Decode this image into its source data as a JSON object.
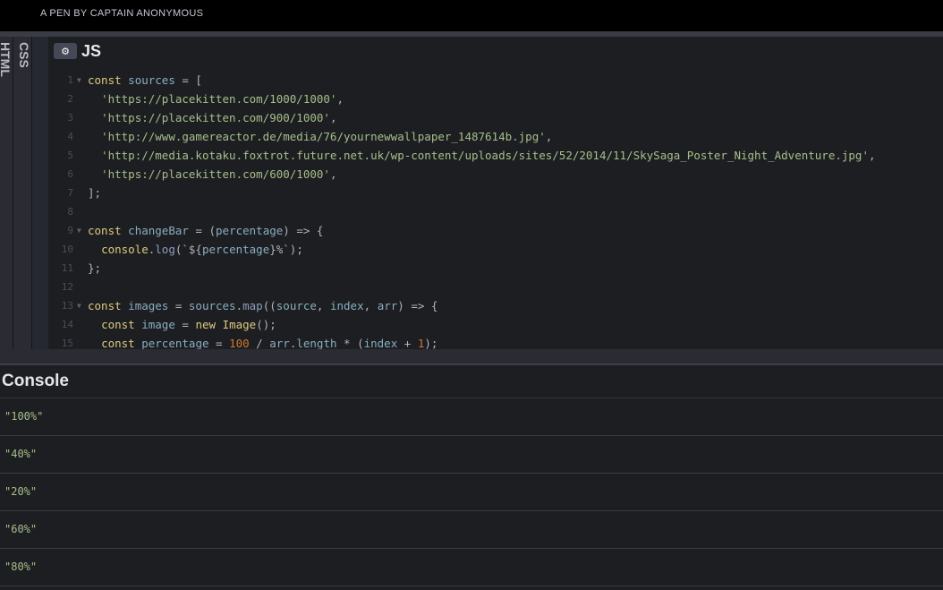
{
  "header": {
    "byline": "A PEN BY CAPTAIN ANONYMOUS"
  },
  "tabs": {
    "html": "HTML",
    "css": "CSS"
  },
  "editor": {
    "title": "JS",
    "settings_icon": "gear-icon",
    "lines": [
      {
        "n": "1",
        "fold": true,
        "tokens": [
          [
            "kw",
            "const"
          ],
          [
            "op",
            " "
          ],
          [
            "var",
            "sources"
          ],
          [
            "op",
            " = ["
          ]
        ]
      },
      {
        "n": "2",
        "fold": false,
        "tokens": [
          [
            "op",
            "  "
          ],
          [
            "str",
            "'https://placekitten.com/1000/1000'"
          ],
          [
            "op",
            ","
          ]
        ]
      },
      {
        "n": "3",
        "fold": false,
        "tokens": [
          [
            "op",
            "  "
          ],
          [
            "str",
            "'https://placekitten.com/900/1000'"
          ],
          [
            "op",
            ","
          ]
        ]
      },
      {
        "n": "4",
        "fold": false,
        "tokens": [
          [
            "op",
            "  "
          ],
          [
            "str",
            "'http://www.gamereactor.de/media/76/yournewwallpaper_1487614b.jpg'"
          ],
          [
            "op",
            ","
          ]
        ]
      },
      {
        "n": "5",
        "fold": false,
        "tokens": [
          [
            "op",
            "  "
          ],
          [
            "str",
            "'http://media.kotaku.foxtrot.future.net.uk/wp-content/uploads/sites/52/2014/11/SkySaga_Poster_Night_Adventure.jpg'"
          ],
          [
            "op",
            ","
          ]
        ]
      },
      {
        "n": "6",
        "fold": false,
        "tokens": [
          [
            "op",
            "  "
          ],
          [
            "str",
            "'https://placekitten.com/600/1000'"
          ],
          [
            "op",
            ","
          ]
        ]
      },
      {
        "n": "7",
        "fold": false,
        "tokens": [
          [
            "op",
            "];"
          ]
        ]
      },
      {
        "n": "8",
        "fold": false,
        "tokens": []
      },
      {
        "n": "9",
        "fold": true,
        "tokens": [
          [
            "kw",
            "const"
          ],
          [
            "op",
            " "
          ],
          [
            "var",
            "changeBar"
          ],
          [
            "op",
            " = ("
          ],
          [
            "var",
            "percentage"
          ],
          [
            "op",
            ") => {"
          ]
        ]
      },
      {
        "n": "10",
        "fold": false,
        "tokens": [
          [
            "op",
            "  "
          ],
          [
            "kw",
            "console"
          ],
          [
            "op",
            "."
          ],
          [
            "fn",
            "log"
          ],
          [
            "op",
            "(`${"
          ],
          [
            "var",
            "percentage"
          ],
          [
            "op",
            "}%`);"
          ]
        ]
      },
      {
        "n": "11",
        "fold": false,
        "tokens": [
          [
            "op",
            "};"
          ]
        ]
      },
      {
        "n": "12",
        "fold": false,
        "tokens": []
      },
      {
        "n": "13",
        "fold": true,
        "tokens": [
          [
            "kw",
            "const"
          ],
          [
            "op",
            " "
          ],
          [
            "var",
            "images"
          ],
          [
            "op",
            " = "
          ],
          [
            "var",
            "sources"
          ],
          [
            "op",
            "."
          ],
          [
            "fn",
            "map"
          ],
          [
            "op",
            "(("
          ],
          [
            "var",
            "source"
          ],
          [
            "op",
            ", "
          ],
          [
            "var",
            "index"
          ],
          [
            "op",
            ", "
          ],
          [
            "var",
            "arr"
          ],
          [
            "op",
            ") => {"
          ]
        ]
      },
      {
        "n": "14",
        "fold": false,
        "tokens": [
          [
            "op",
            "  "
          ],
          [
            "kw",
            "const"
          ],
          [
            "op",
            " "
          ],
          [
            "var",
            "image"
          ],
          [
            "op",
            " = "
          ],
          [
            "kw",
            "new"
          ],
          [
            "op",
            " "
          ],
          [
            "kw",
            "Image"
          ],
          [
            "op",
            "();"
          ]
        ]
      },
      {
        "n": "15",
        "fold": false,
        "tokens": [
          [
            "op",
            "  "
          ],
          [
            "kw",
            "const"
          ],
          [
            "op",
            " "
          ],
          [
            "var",
            "percentage"
          ],
          [
            "op",
            " = "
          ],
          [
            "num",
            "100"
          ],
          [
            "op",
            " / "
          ],
          [
            "var",
            "arr"
          ],
          [
            "op",
            "."
          ],
          [
            "var",
            "length"
          ],
          [
            "op",
            " * ("
          ],
          [
            "var",
            "index"
          ],
          [
            "op",
            " + "
          ],
          [
            "num",
            "1"
          ],
          [
            "op",
            ");"
          ]
        ]
      }
    ]
  },
  "console": {
    "title": "Console",
    "entries": [
      "\"100%\"",
      "\"40%\"",
      "\"20%\"",
      "\"60%\"",
      "\"80%\""
    ]
  }
}
